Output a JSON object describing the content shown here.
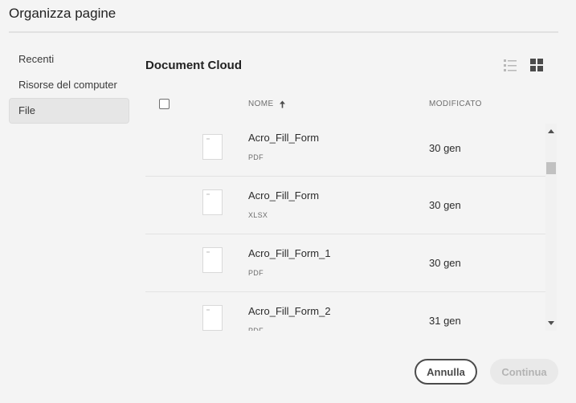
{
  "dialog": {
    "title": "Organizza pagine"
  },
  "sidebar": {
    "items": [
      {
        "label": "Recenti",
        "active": false
      },
      {
        "label": "Risorse del computer",
        "active": false
      },
      {
        "label": "File",
        "active": true
      }
    ]
  },
  "main": {
    "section_title": "Document Cloud",
    "view_icons": [
      "list-view-icon",
      "grid-view-icon"
    ],
    "columns": {
      "name": "NOME",
      "sort": "ascending",
      "modified": "MODIFICATO"
    },
    "files": [
      {
        "name": "Acro_Fill_Form",
        "type": "PDF",
        "modified": "30 gen"
      },
      {
        "name": "Acro_Fill_Form",
        "type": "XLSX",
        "modified": "30 gen"
      },
      {
        "name": "Acro_Fill_Form_1",
        "type": "PDF",
        "modified": "30 gen"
      },
      {
        "name": "Acro_Fill_Form_2",
        "type": "PDF",
        "modified": "31 gen"
      }
    ]
  },
  "footer": {
    "cancel_label": "Annulla",
    "continue_label": "Continua"
  },
  "colors": {
    "background": "#f4f4f4",
    "selected_item": "#e6e6e6",
    "button_border": "#4b4b4b",
    "disabled_text": "#b3b3b3"
  }
}
